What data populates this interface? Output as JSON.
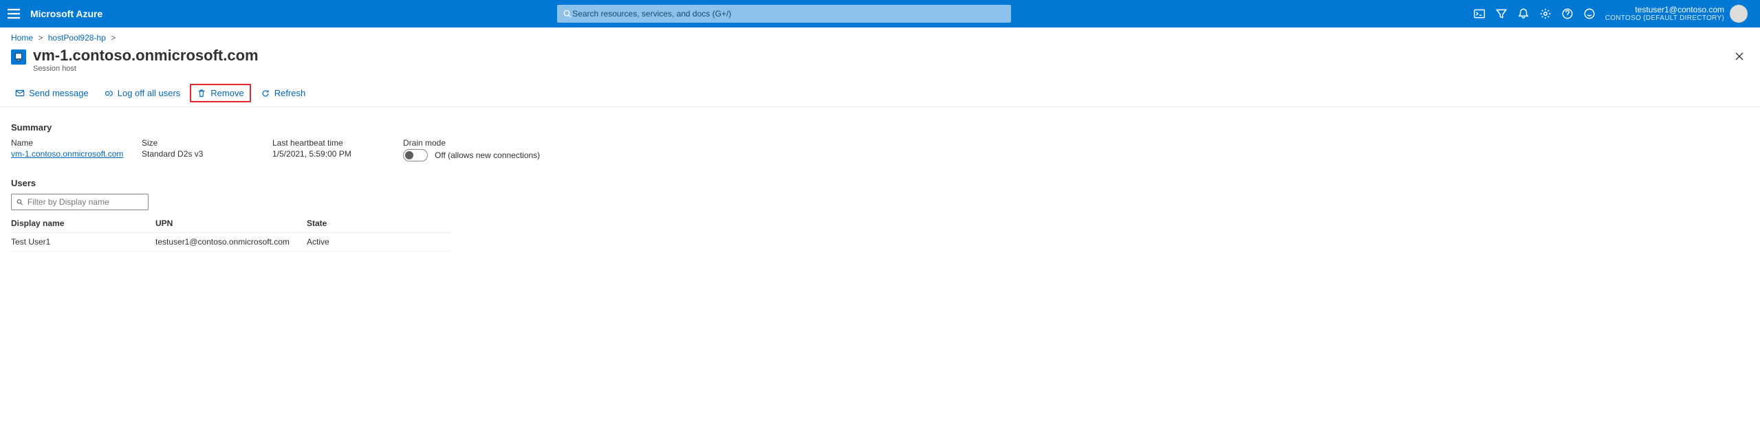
{
  "brand": "Microsoft Azure",
  "search": {
    "placeholder": "Search resources, services, and docs (G+/)"
  },
  "account": {
    "email": "testuser1@contoso.com",
    "directory": "CONTOSO (DEFAULT DIRECTORY)"
  },
  "breadcrumb": {
    "home": "Home",
    "hostpool": "hostPool928-hp"
  },
  "resource": {
    "title": "vm-1.contoso.onmicrosoft.com",
    "subtitle": "Session host"
  },
  "commands": {
    "send_message": "Send message",
    "log_off": "Log off all users",
    "remove": "Remove",
    "refresh": "Refresh"
  },
  "summary": {
    "title": "Summary",
    "name_label": "Name",
    "name_value": "vm-1.contoso.onmicrosoft.com",
    "size_label": "Size",
    "size_value": "Standard D2s v3",
    "heartbeat_label": "Last heartbeat time",
    "heartbeat_value": "1/5/2021, 5:59:00 PM",
    "drain_label": "Drain mode",
    "drain_toggle_text": "Off (allows new connections)",
    "drain_on": false
  },
  "users": {
    "title": "Users",
    "filter_placeholder": "Filter by Display name",
    "columns": {
      "display": "Display name",
      "upn": "UPN",
      "state": "State"
    },
    "rows": [
      {
        "display": "Test User1",
        "upn": "testuser1@contoso.onmicrosoft.com",
        "state": "Active"
      }
    ]
  }
}
